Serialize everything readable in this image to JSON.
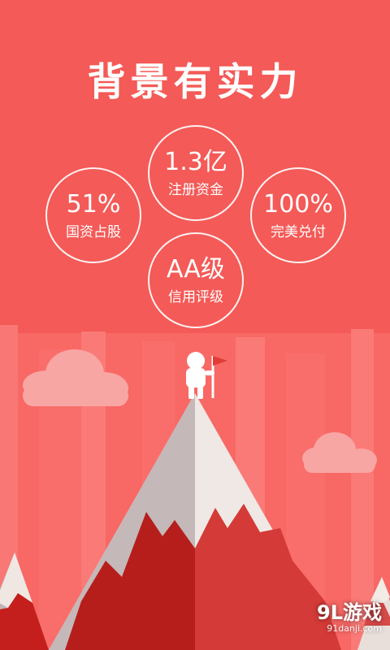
{
  "title": "背景有实力",
  "stats": [
    {
      "value": "1.3亿",
      "label": "注册资金"
    },
    {
      "value": "51%",
      "label": "国资占股"
    },
    {
      "value": "100%",
      "label": "完美兑付"
    },
    {
      "value": "AA级",
      "label": "信用评级"
    }
  ],
  "watermark": {
    "brand": "9L游戏",
    "domain": "91danji.com"
  },
  "colors": {
    "background": "#f45a57",
    "mountain_red": "#c0211f",
    "snow": "#f0e6e1",
    "cloud": "#f8a6a4"
  },
  "icons": [
    "climber-icon",
    "flag-icon",
    "cloud-icon",
    "mountain-icon"
  ]
}
